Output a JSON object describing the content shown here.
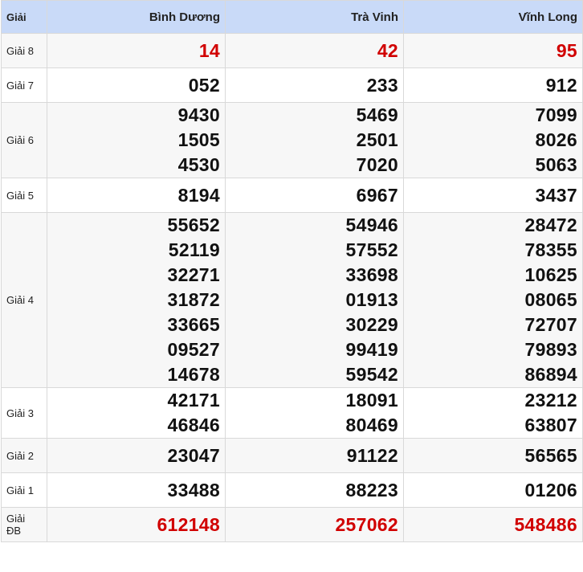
{
  "header": {
    "label": "Giải",
    "provinces": [
      "Bình Dương",
      "Trà Vinh",
      "Vĩnh Long"
    ]
  },
  "colors": {
    "header_bg": "#c9daf8",
    "special_red": "#d10000"
  },
  "prizes": [
    {
      "label": "Giải 8",
      "highlight": true,
      "values": [
        [
          "14"
        ],
        [
          "42"
        ],
        [
          "95"
        ]
      ]
    },
    {
      "label": "Giải 7",
      "highlight": false,
      "values": [
        [
          "052"
        ],
        [
          "233"
        ],
        [
          "912"
        ]
      ]
    },
    {
      "label": "Giải 6",
      "highlight": false,
      "values": [
        [
          "9430",
          "1505",
          "4530"
        ],
        [
          "5469",
          "2501",
          "7020"
        ],
        [
          "7099",
          "8026",
          "5063"
        ]
      ]
    },
    {
      "label": "Giải 5",
      "highlight": false,
      "values": [
        [
          "8194"
        ],
        [
          "6967"
        ],
        [
          "3437"
        ]
      ]
    },
    {
      "label": "Giải 4",
      "highlight": false,
      "values": [
        [
          "55652",
          "52119",
          "32271",
          "31872",
          "33665",
          "09527",
          "14678"
        ],
        [
          "54946",
          "57552",
          "33698",
          "01913",
          "30229",
          "99419",
          "59542"
        ],
        [
          "28472",
          "78355",
          "10625",
          "08065",
          "72707",
          "79893",
          "86894"
        ]
      ]
    },
    {
      "label": "Giải 3",
      "highlight": false,
      "values": [
        [
          "42171",
          "46846"
        ],
        [
          "18091",
          "80469"
        ],
        [
          "23212",
          "63807"
        ]
      ]
    },
    {
      "label": "Giải 2",
      "highlight": false,
      "values": [
        [
          "23047"
        ],
        [
          "91122"
        ],
        [
          "56565"
        ]
      ]
    },
    {
      "label": "Giải 1",
      "highlight": false,
      "values": [
        [
          "33488"
        ],
        [
          "88223"
        ],
        [
          "01206"
        ]
      ]
    },
    {
      "label": "Giải ĐB",
      "highlight": true,
      "values": [
        [
          "612148"
        ],
        [
          "257062"
        ],
        [
          "548486"
        ]
      ]
    }
  ]
}
